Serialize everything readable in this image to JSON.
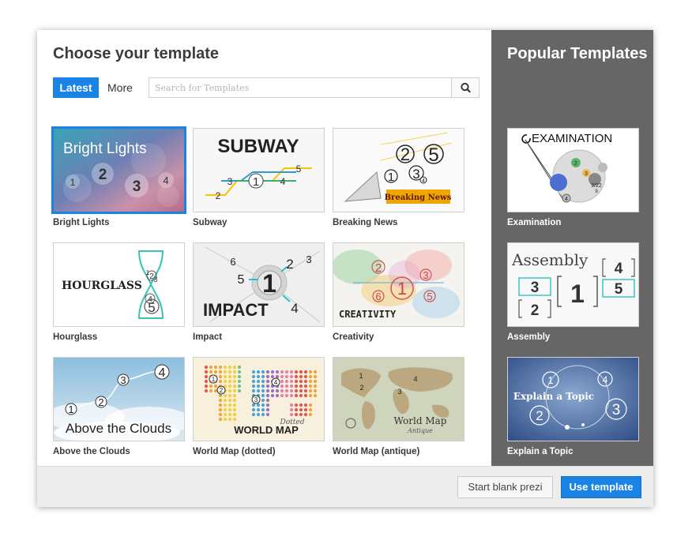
{
  "dialog": {
    "title": "Choose your template",
    "tabs": [
      {
        "label": "Latest",
        "active": true
      },
      {
        "label": "More",
        "active": false
      }
    ],
    "search": {
      "placeholder": "Search for Templates",
      "value": "",
      "icon": "search-icon"
    },
    "templates": [
      {
        "name": "Bright Lights",
        "selected": true,
        "thumb_text": "Bright Lights",
        "thumb_numbers": [
          "1",
          "2",
          "3",
          "4"
        ]
      },
      {
        "name": "Subway",
        "selected": false,
        "thumb_text": "SUBWAY",
        "thumb_numbers": [
          "1",
          "2",
          "3",
          "4",
          "5"
        ]
      },
      {
        "name": "Breaking News",
        "selected": false,
        "thumb_text": "Breaking News",
        "thumb_numbers": [
          "1",
          "2",
          "3",
          "4",
          "5"
        ]
      },
      {
        "name": "Hourglass",
        "selected": false,
        "thumb_text": "HOURGLASS",
        "thumb_numbers": [
          "1",
          "2",
          "3",
          "4",
          "5"
        ]
      },
      {
        "name": "Impact",
        "selected": false,
        "thumb_text": "IMPACT",
        "thumb_numbers": [
          "1",
          "2",
          "3",
          "4",
          "5",
          "6"
        ]
      },
      {
        "name": "Creativity",
        "selected": false,
        "thumb_text": "CREATIVITY",
        "thumb_numbers": [
          "1",
          "2",
          "3",
          "5",
          "6"
        ]
      },
      {
        "name": "Above the Clouds",
        "selected": false,
        "thumb_text": "Above the Clouds",
        "thumb_numbers": [
          "1",
          "2",
          "3",
          "4"
        ]
      },
      {
        "name": "World Map (dotted)",
        "selected": false,
        "thumb_text": "WORLD MAP",
        "thumb_subtext": "Dotted",
        "thumb_numbers": [
          "1",
          "2",
          "3",
          "4"
        ]
      },
      {
        "name": "World Map (antique)",
        "selected": false,
        "thumb_text": "World Map",
        "thumb_subtext": "Antique",
        "thumb_numbers": [
          "1",
          "2",
          "3",
          "4"
        ]
      }
    ]
  },
  "popular": {
    "title": "Popular Templates",
    "templates": [
      {
        "name": "Examination",
        "thumb_text": "EXAMINATION",
        "thumb_numbers": [
          "2",
          "3",
          "4",
          "9"
        ],
        "thumb_small": "9/22"
      },
      {
        "name": "Assembly",
        "thumb_text": "Assembly",
        "thumb_numbers": [
          "1",
          "2",
          "3",
          "4",
          "5"
        ]
      },
      {
        "name": "Explain a Topic",
        "thumb_text": "Explain a Topic",
        "thumb_numbers": [
          "1",
          "2",
          "3",
          "4"
        ]
      }
    ]
  },
  "footer": {
    "blank_label": "Start blank prezi",
    "use_label": "Use template"
  },
  "colors": {
    "accent": "#1a84e6",
    "sidebar": "#666666",
    "footer": "#ededed",
    "title_text": "#3c3c3c"
  }
}
